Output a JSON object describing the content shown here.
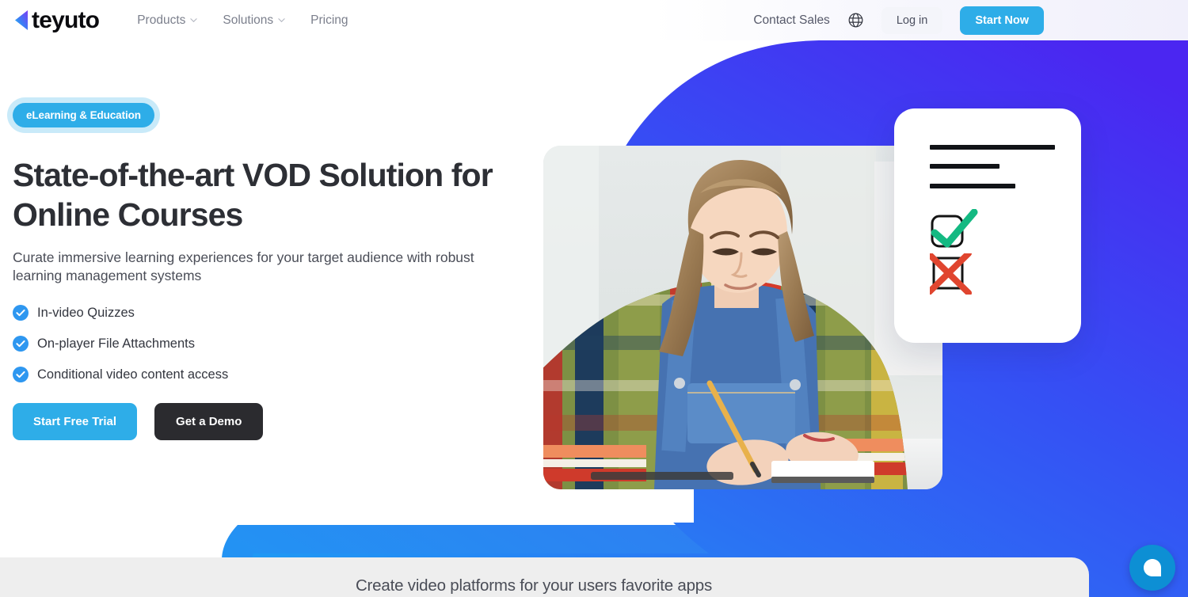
{
  "navbar": {
    "logo_text": "teyuto",
    "logo_icon": "teyuto-triangle-logo",
    "links": [
      {
        "label": "Products",
        "has_chevron": true,
        "icon": "chevron-down-icon"
      },
      {
        "label": "Solutions",
        "has_chevron": true,
        "icon": "chevron-down-icon"
      },
      {
        "label": "Pricing",
        "has_chevron": false,
        "icon": ""
      }
    ],
    "contact_sales": "Contact Sales",
    "language_icon": "globe-icon",
    "login_label": "Log in",
    "start_now_label": "Start Now"
  },
  "hero": {
    "badge": "eLearning & Education",
    "title": "State-of-the-art VOD Solution for Online Courses",
    "subtitle": "Curate immersive learning experiences for your target audience with robust learning management systems",
    "features": [
      {
        "label": "In-video Quizzes",
        "icon": "check-circle-icon"
      },
      {
        "label": "On-player File Attachments",
        "icon": "check-circle-icon"
      },
      {
        "label": "Conditional video content access",
        "icon": "check-circle-icon"
      }
    ],
    "primary_cta": "Start Free Trial",
    "secondary_cta": "Get a Demo",
    "photo_alt": "student-writing-photo",
    "quiz_card": {
      "name": "quiz-card",
      "line_icons": [
        "text-line-icon",
        "text-line-icon",
        "text-line-icon"
      ],
      "options": [
        {
          "icon": "checkbox-checked-green-icon",
          "state": "correct"
        },
        {
          "icon": "checkbox-crossed-red-icon",
          "state": "incorrect"
        }
      ]
    }
  },
  "bottom_section": {
    "title": "Create video platforms for your users favorite apps"
  },
  "chat": {
    "icon": "chat-bubble-icon",
    "label": "Open chat"
  },
  "colors": {
    "accent_blue": "#2eade8",
    "deep_blue": "#2f6bf5",
    "violet": "#4234f0",
    "dark": "#2b2b2f",
    "text_body": "#4a4d57",
    "green_check": "#14b982",
    "red_cross": "#e0452f",
    "panel_gray": "#eeeeee",
    "chat_blue": "#0d8fd4"
  }
}
